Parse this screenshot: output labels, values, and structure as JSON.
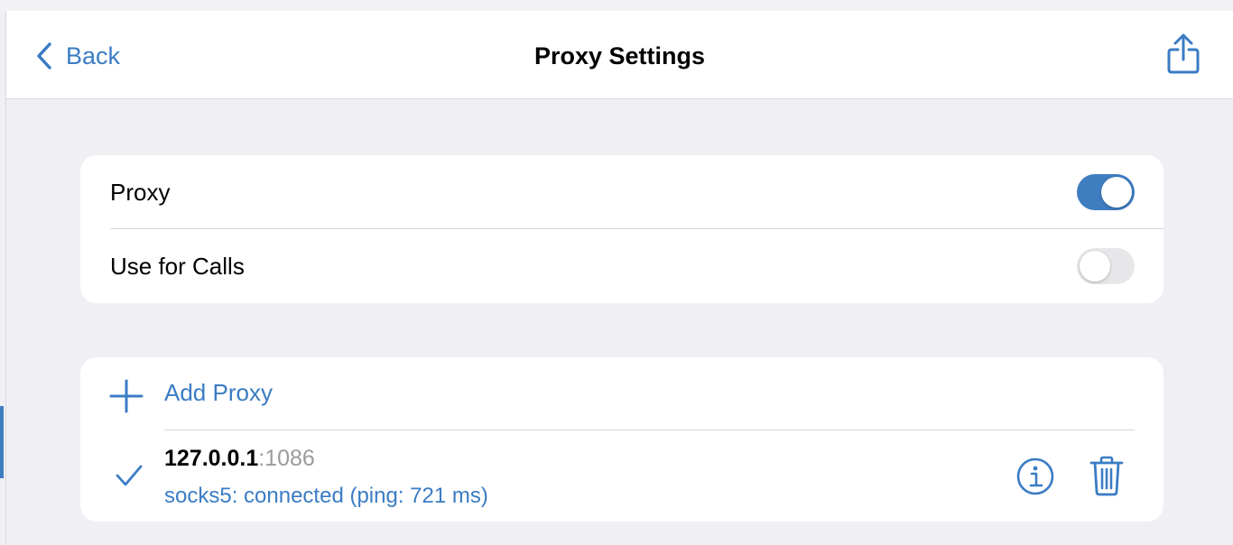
{
  "navbar": {
    "back_label": "Back",
    "title": "Proxy Settings",
    "share_icon": "share-icon"
  },
  "settings": {
    "proxy": {
      "label": "Proxy",
      "enabled": true
    },
    "use_for_calls": {
      "label": "Use for Calls",
      "enabled": false
    }
  },
  "proxies": {
    "add_label": "Add Proxy",
    "items": [
      {
        "host": "127.0.0.1",
        "port_text": ":1086",
        "status": "socks5: connected (ping: 721 ms)",
        "selected": true
      }
    ]
  },
  "colors": {
    "accent": "#3f7dc1",
    "link": "#3a7cc4",
    "background": "#efeff4",
    "toggle_off": "#e7e7ea"
  }
}
